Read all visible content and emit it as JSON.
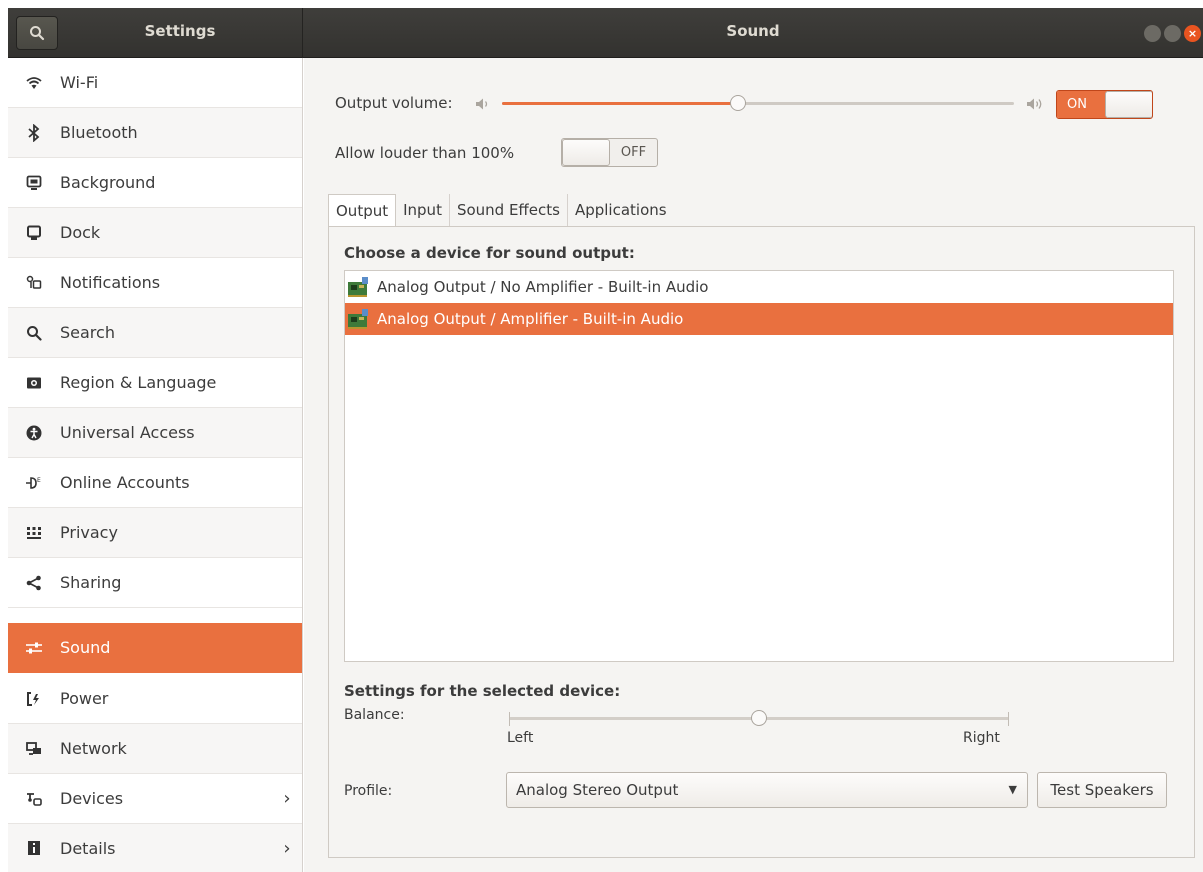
{
  "header": {
    "app_title": "Settings",
    "page_title": "Sound"
  },
  "sidebar": {
    "items": [
      {
        "label": "Wi-Fi",
        "icon": "wifi-icon"
      },
      {
        "label": "Bluetooth",
        "icon": "bluetooth-icon"
      },
      {
        "label": "Background",
        "icon": "background-icon"
      },
      {
        "label": "Dock",
        "icon": "dock-icon"
      },
      {
        "label": "Notifications",
        "icon": "notifications-icon"
      },
      {
        "label": "Search",
        "icon": "search-icon"
      },
      {
        "label": "Region & Language",
        "icon": "region-icon"
      },
      {
        "label": "Universal Access",
        "icon": "accessibility-icon"
      },
      {
        "label": "Online Accounts",
        "icon": "online-accounts-icon"
      },
      {
        "label": "Privacy",
        "icon": "privacy-icon"
      },
      {
        "label": "Sharing",
        "icon": "sharing-icon"
      },
      {
        "label": "Sound",
        "icon": "sound-icon",
        "active": true
      },
      {
        "label": "Power",
        "icon": "power-icon"
      },
      {
        "label": "Network",
        "icon": "network-icon"
      },
      {
        "label": "Devices",
        "icon": "devices-icon",
        "chevron": true
      },
      {
        "label": "Details",
        "icon": "details-icon",
        "chevron": true
      }
    ]
  },
  "output_volume": {
    "label": "Output volume:",
    "level_fraction": 0.46,
    "switch_label": "ON",
    "switch_state": "on"
  },
  "allow_louder": {
    "label": "Allow louder than 100%",
    "switch_label": "OFF",
    "switch_state": "off"
  },
  "tabs": [
    "Output",
    "Input",
    "Sound Effects",
    "Applications"
  ],
  "active_tab": "Output",
  "output": {
    "choose_heading": "Choose a device for sound output:",
    "devices": [
      {
        "label": "Analog Output / No Amplifier - Built-in Audio",
        "selected": false
      },
      {
        "label": "Analog Output / Amplifier - Built-in Audio",
        "selected": true
      }
    ],
    "settings_heading": "Settings for the selected device:",
    "balance": {
      "label": "Balance:",
      "left_label": "Left",
      "right_label": "Right",
      "level_fraction": 0.5
    },
    "profile": {
      "label": "Profile:",
      "value": "Analog Stereo Output"
    },
    "test_button": "Test Speakers"
  },
  "colors": {
    "accent": "#e9703f",
    "headerbar": "#3a3936",
    "close_button": "#e95420"
  }
}
